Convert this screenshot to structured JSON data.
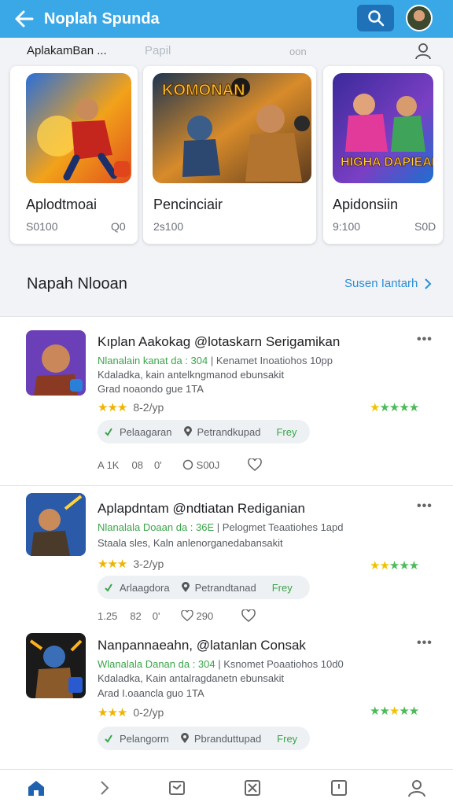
{
  "header": {
    "title": "Noplah Spunda",
    "back_icon": "arrow-left-icon",
    "search_icon": "search-icon",
    "avatar_icon": "avatar"
  },
  "featured": {
    "header": "AplakamBan ...",
    "tab2": "Papil",
    "tab3": "oon",
    "cards": [
      {
        "name": "Aplodtmoai",
        "meta_left": "S0100",
        "meta_right": "Q0"
      },
      {
        "name": "Pencinciair",
        "meta_left": "2s100",
        "meta_right": "",
        "art_text": "KOMONAN"
      },
      {
        "name": "Apidonsiin",
        "meta_left": "9:100",
        "meta_right": "S0D",
        "art_text": "HIGHA DAPIEAN"
      }
    ]
  },
  "section": {
    "title": "Napah Nlooan",
    "link": "Susen Iantarh"
  },
  "items": [
    {
      "title": "Kıplan Aakokag @lotaskarn Serigamikan",
      "sub_green": "Nlanalain kanat da : 304",
      "sub_grey": "| Kenamet Inoatiohos 10pp",
      "desc": "Kdaladka, kain antelkngmanod ebunsakit",
      "desc2": "Grad noaondo gue 1TA",
      "rating_text": "8-2/yp",
      "chip1": "Pelaagaran",
      "chip2": "Petrandkupad",
      "chip3": "Frey",
      "act1": "A 1K",
      "act2": "08",
      "act3": "0'",
      "act4": "S00J"
    },
    {
      "title": "Aplapdntam @ndtiatan Rediganian",
      "sub_green": "Nlanalala Doaan da : 36E",
      "sub_grey": "| Pelogmet Teaatiohes 1apd",
      "desc": "Staala sles, Kaln anlenorganedabansakit",
      "desc2": "",
      "rating_text": "3-2/yp",
      "chip1": "Arlaagdora",
      "chip2": "Petrandtanad",
      "chip3": "Frey",
      "act1": "1.25",
      "act2": "82",
      "act3": "0'",
      "act4": "290"
    },
    {
      "title": "Nanpannaeahn, @latanlan Consak",
      "sub_green": "Wlanalala Danan da : 304",
      "sub_grey": "| Ksnomet Poaatiohos 10d0",
      "desc": "Kdaladka, Kain antalragdanetn ebunsakit",
      "desc2": "Arad I.oaancla guo 1TA",
      "rating_text": "0-2/yp",
      "chip1": "Pelangorm",
      "chip2": "Pbranduttupad",
      "chip3": "Frey",
      "act1": "",
      "act2": "",
      "act3": "",
      "act4": ""
    }
  ],
  "bottom_nav": [
    "home-icon",
    "chevron-right-icon",
    "inbox-icon",
    "crossed-box-icon",
    "clock-card-icon",
    "profile-icon"
  ],
  "colors": {
    "topbar": "#3aa8e6",
    "search_btn": "#1f72b8",
    "green": "#3aa54a",
    "link": "#2a8fd6",
    "star_yellow": "#f0b400"
  }
}
